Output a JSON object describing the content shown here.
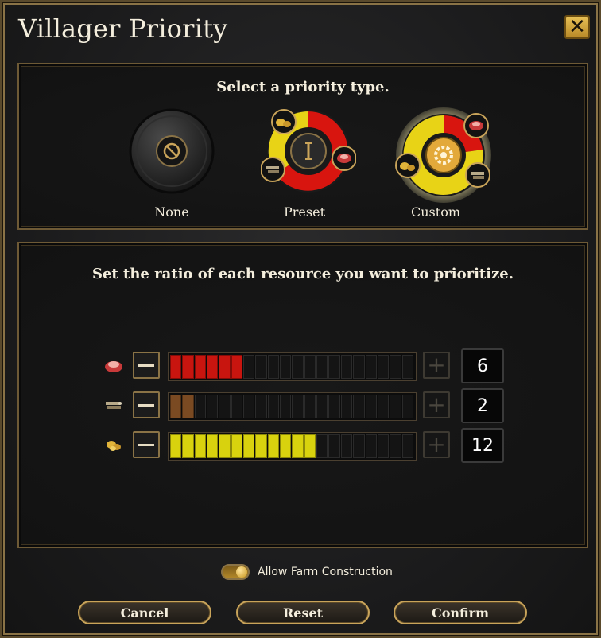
{
  "dialog": {
    "title": "Villager Priority",
    "close_icon": "close-icon"
  },
  "priority_type": {
    "heading": "Select a priority type.",
    "options": [
      {
        "label": "None",
        "icon": "disabled-icon",
        "selected": false
      },
      {
        "label": "Preset",
        "icon": "roman-numeral-one-icon",
        "selected": false
      },
      {
        "label": "Custom",
        "icon": "gear-icon",
        "selected": true
      }
    ]
  },
  "ratio": {
    "heading": "Set the ratio of each resource you want to prioritize.",
    "total_segments": 20,
    "resources": [
      {
        "name": "food",
        "icon": "meat-icon",
        "value": "6",
        "filled": 6,
        "color": "#c8150f"
      },
      {
        "name": "wood",
        "icon": "wood-logs-icon",
        "value": "2",
        "filled": 2,
        "color": "#7a4a22"
      },
      {
        "name": "gold",
        "icon": "gold-nuggets-icon",
        "value": "12",
        "filled": 12,
        "color": "#d8d20e"
      }
    ]
  },
  "toggle": {
    "label": "Allow Farm Construction",
    "on": true
  },
  "buttons": {
    "cancel": "Cancel",
    "reset": "Reset",
    "confirm": "Confirm"
  },
  "colors": {
    "accent_gold": "#c9a45a",
    "food": "#c8150f",
    "wood": "#7a4a22",
    "gold": "#d8d20e"
  }
}
